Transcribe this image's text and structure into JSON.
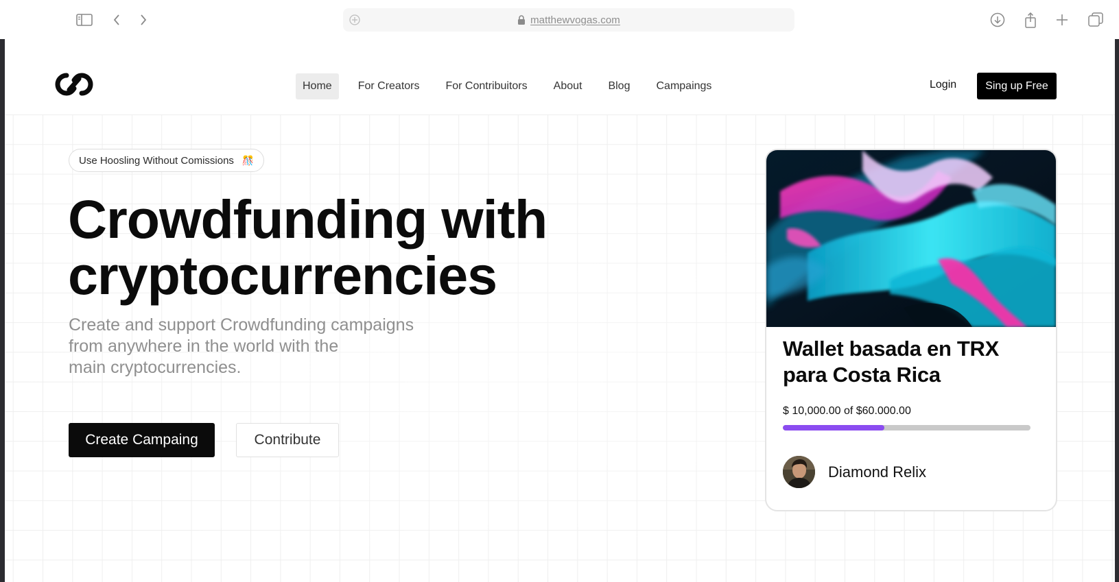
{
  "browser": {
    "url": "matthewvogas.com",
    "icons": [
      "sidebar-icon",
      "back-icon",
      "forward-icon",
      "add-tab-icon",
      "lock-icon",
      "download-icon",
      "share-icon",
      "new-tab-icon",
      "tabs-overview-icon"
    ]
  },
  "nav": {
    "items": [
      {
        "label": "Home",
        "active": true
      },
      {
        "label": "For Creators"
      },
      {
        "label": "For Contribuitors"
      },
      {
        "label": "About"
      },
      {
        "label": "Blog"
      },
      {
        "label": "Campaings"
      }
    ],
    "login": "Login",
    "signup": "Sing up Free"
  },
  "hero": {
    "pill": "Use Hoosling Without Comissions",
    "pill_emoji": "🎊",
    "headline_line1": "Crowdfunding with",
    "headline_line2": "cryptocurrencies",
    "sub_line1": "Create and support Crowdfunding campaigns",
    "sub_line2": "from anywhere in the world with the",
    "sub_line3": "main cryptocurrencies.",
    "create_button": "Create Campaing",
    "contribute_button": "Contribute"
  },
  "card": {
    "title_line1": "Wallet basada en TRX",
    "title_line2": "para Costa Rica",
    "progress_text": "$ 10,000.00 of $60.000.00",
    "progress_fraction": 0.41,
    "author": "Diamond Relix"
  },
  "colors": {
    "accent": "#8b4cf0",
    "primary_button": "#0b0b0b",
    "muted_text": "#8f8f8f"
  }
}
